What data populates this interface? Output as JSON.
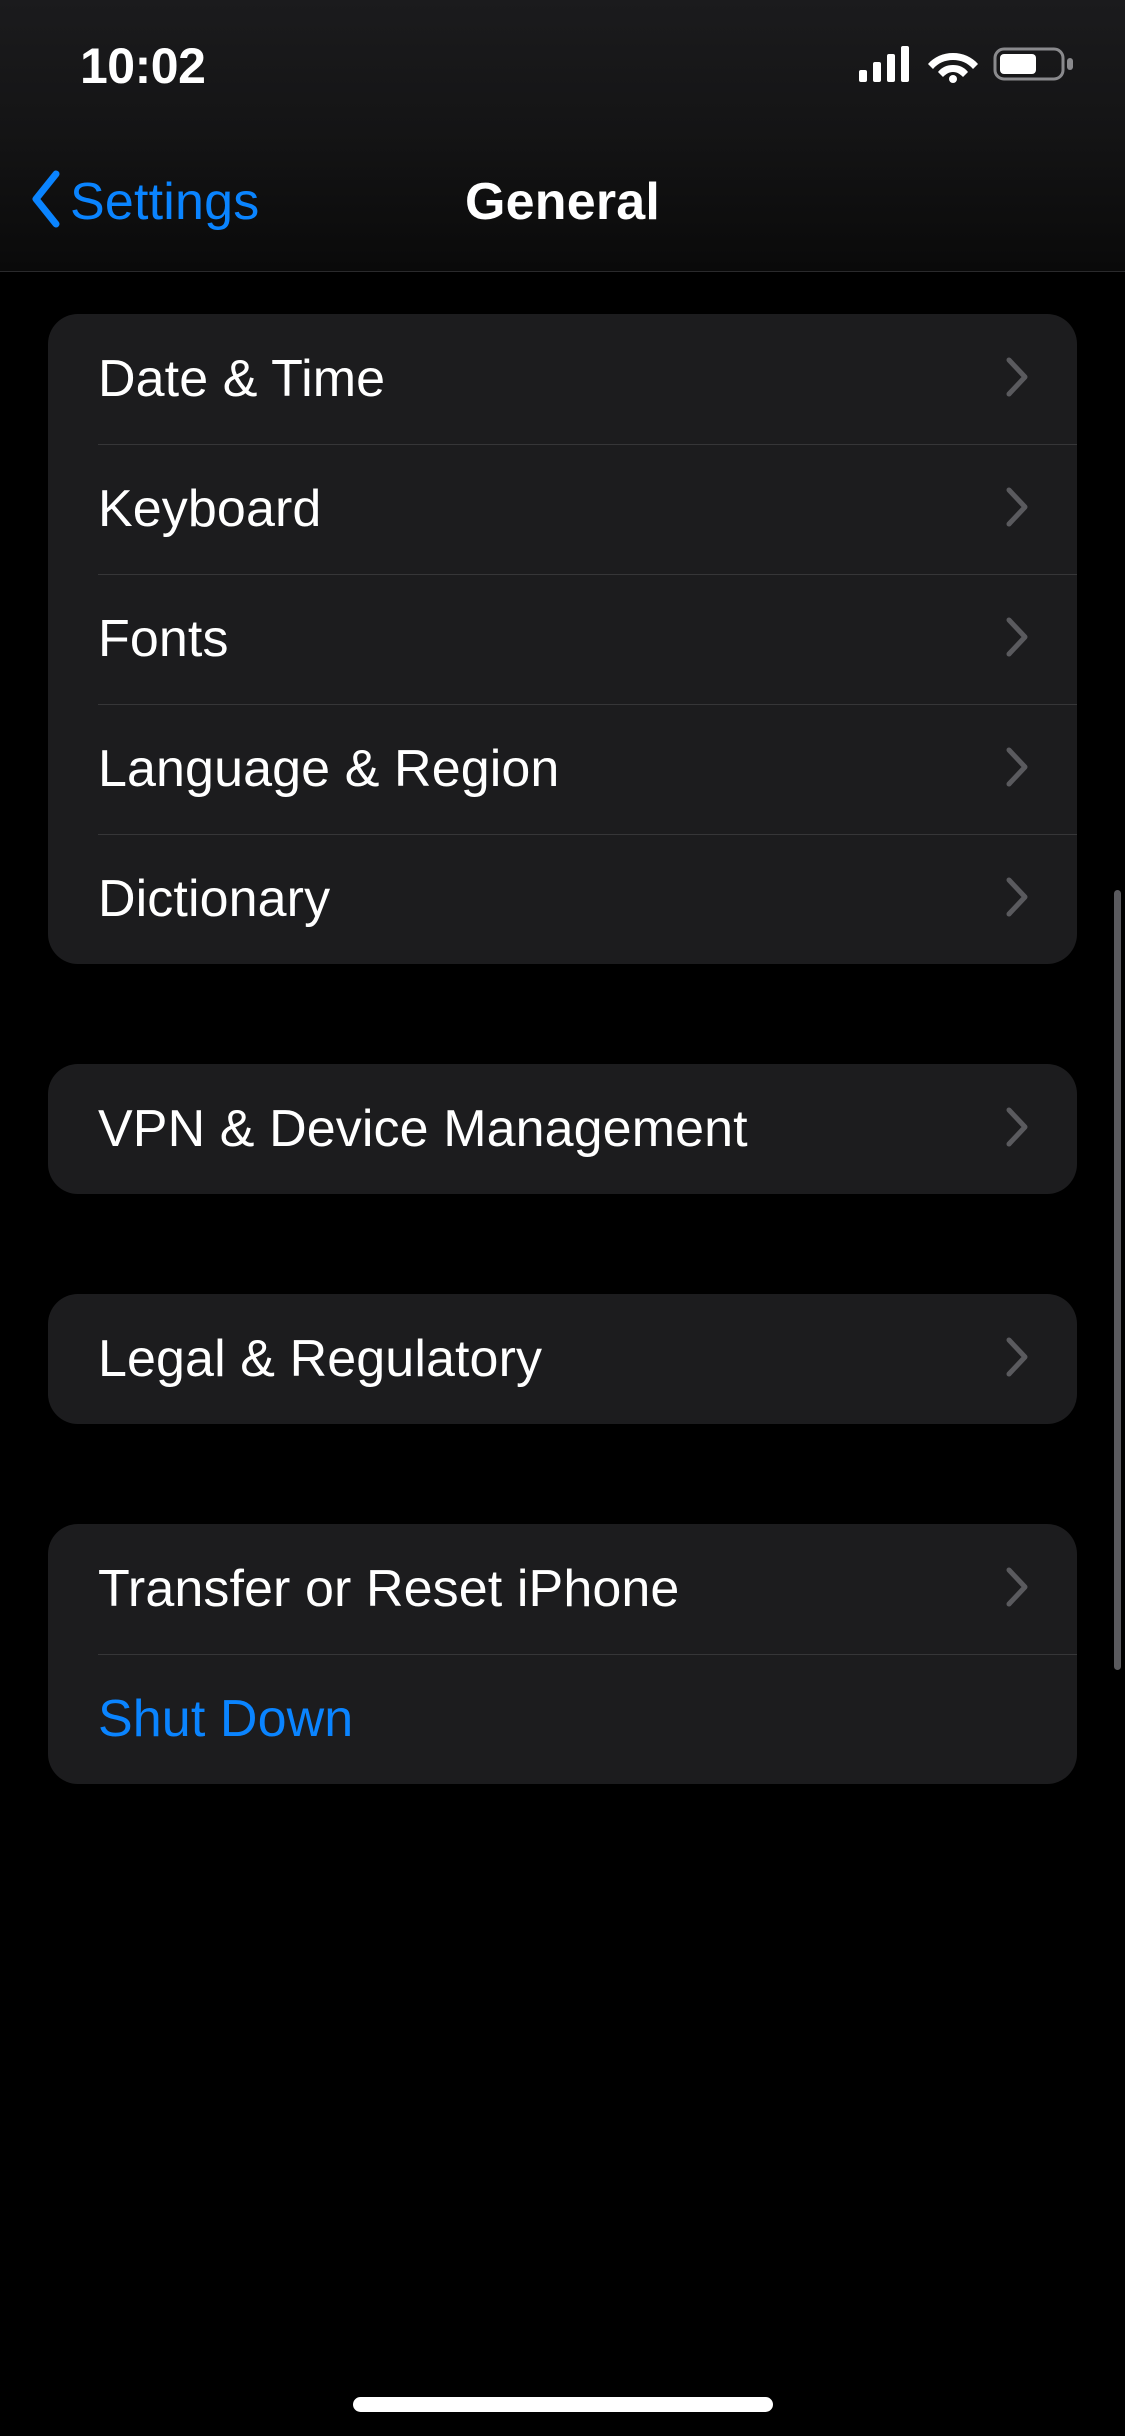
{
  "statusBar": {
    "time": "10:02"
  },
  "nav": {
    "back_label": "Settings",
    "title": "General"
  },
  "groups": [
    {
      "rows": [
        {
          "label": "Date & Time"
        },
        {
          "label": "Keyboard"
        },
        {
          "label": "Fonts"
        },
        {
          "label": "Language & Region"
        },
        {
          "label": "Dictionary"
        }
      ]
    },
    {
      "rows": [
        {
          "label": "VPN & Device Management"
        }
      ]
    },
    {
      "rows": [
        {
          "label": "Legal & Regulatory"
        }
      ]
    },
    {
      "rows": [
        {
          "label": "Transfer or Reset iPhone",
          "disclosure": true
        },
        {
          "label": "Shut Down",
          "accent": true,
          "disclosure": false
        }
      ]
    }
  ],
  "colors": {
    "accent": "#0a84ff",
    "cell_bg": "#1c1c1e",
    "separator": "#363638",
    "chevron": "#5a5a5e"
  }
}
